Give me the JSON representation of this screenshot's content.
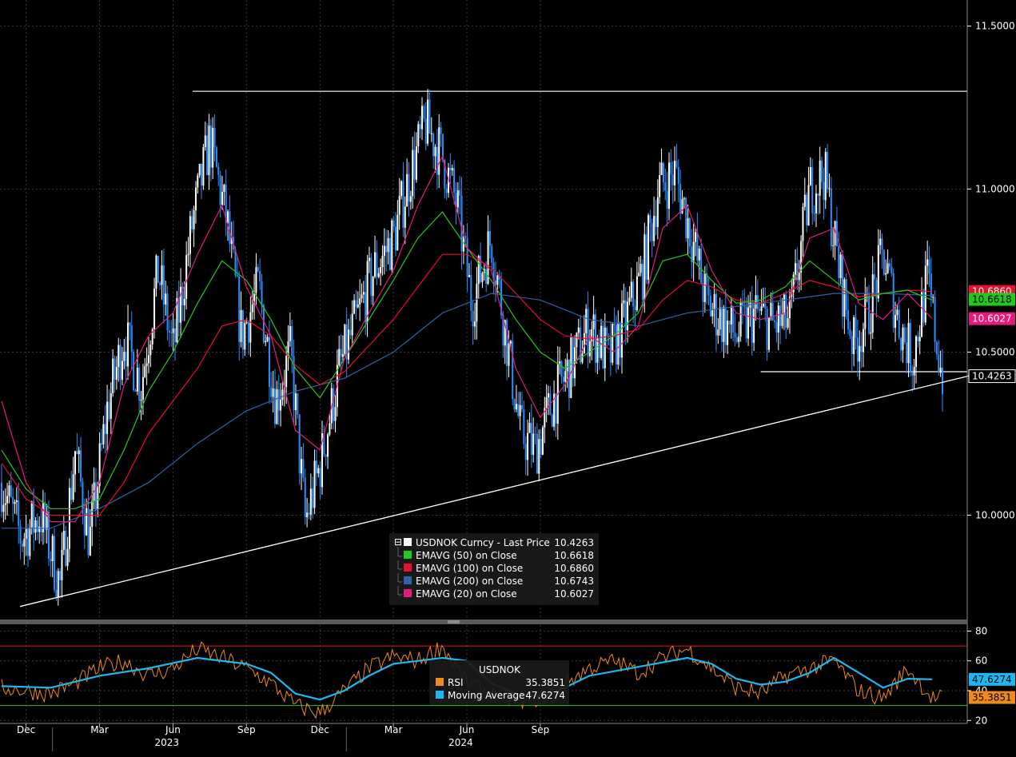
{
  "chart_data": {
    "type": "line",
    "price_panel": {
      "y_ticks": [
        "11.5000",
        "11.0000",
        "10.5000",
        "10.0000"
      ],
      "ylim": [
        9.68,
        11.58
      ],
      "grid": true,
      "legend_placement": "bottom-center",
      "colors": {
        "price": "#ffffff",
        "ema50": "#22c81e",
        "ema100": "#e8102a",
        "ema200": "#2f62a8",
        "ema20": "#e6197c",
        "trendline": "#ffffff",
        "candle_down": "#2b8fff"
      },
      "price_points": [
        {
          "x": 0.0,
          "y": 10.1
        },
        {
          "x": 0.8,
          "y": 9.93
        },
        {
          "x": 1.6,
          "y": 10.0
        },
        {
          "x": 2.4,
          "y": 9.78
        },
        {
          "x": 3.0,
          "y": 10.2
        },
        {
          "x": 3.6,
          "y": 9.92
        },
        {
          "x": 4.3,
          "y": 10.32
        },
        {
          "x": 5.0,
          "y": 10.55
        },
        {
          "x": 5.7,
          "y": 10.4
        },
        {
          "x": 6.4,
          "y": 10.75
        },
        {
          "x": 7.0,
          "y": 10.5
        },
        {
          "x": 7.8,
          "y": 10.9
        },
        {
          "x": 8.5,
          "y": 11.15
        },
        {
          "x": 9.2,
          "y": 10.9
        },
        {
          "x": 9.8,
          "y": 10.55
        },
        {
          "x": 10.5,
          "y": 10.7
        },
        {
          "x": 11.2,
          "y": 10.35
        },
        {
          "x": 11.8,
          "y": 10.5
        },
        {
          "x": 12.4,
          "y": 9.98
        },
        {
          "x": 13.0,
          "y": 10.15
        },
        {
          "x": 13.8,
          "y": 10.45
        },
        {
          "x": 14.5,
          "y": 10.6
        },
        {
          "x": 15.2,
          "y": 10.75
        },
        {
          "x": 16.0,
          "y": 10.85
        },
        {
          "x": 16.7,
          "y": 11.05
        },
        {
          "x": 17.3,
          "y": 11.2
        },
        {
          "x": 18.0,
          "y": 11.1
        },
        {
          "x": 18.6,
          "y": 10.95
        },
        {
          "x": 19.2,
          "y": 10.65
        },
        {
          "x": 20.0,
          "y": 10.85
        },
        {
          "x": 20.6,
          "y": 10.55
        },
        {
          "x": 21.2,
          "y": 10.25
        },
        {
          "x": 21.8,
          "y": 10.2
        },
        {
          "x": 22.5,
          "y": 10.35
        },
        {
          "x": 23.2,
          "y": 10.45
        },
        {
          "x": 24.0,
          "y": 10.58
        },
        {
          "x": 24.8,
          "y": 10.48
        },
        {
          "x": 25.5,
          "y": 10.6
        },
        {
          "x": 26.2,
          "y": 10.75
        },
        {
          "x": 26.8,
          "y": 11.0
        },
        {
          "x": 27.5,
          "y": 11.05
        },
        {
          "x": 28.2,
          "y": 10.85
        },
        {
          "x": 28.8,
          "y": 10.65
        },
        {
          "x": 29.4,
          "y": 10.6
        },
        {
          "x": 30.0,
          "y": 10.55
        },
        {
          "x": 30.8,
          "y": 10.62
        },
        {
          "x": 31.5,
          "y": 10.58
        },
        {
          "x": 32.2,
          "y": 10.6
        },
        {
          "x": 33.0,
          "y": 11.0
        },
        {
          "x": 33.6,
          "y": 11.05
        },
        {
          "x": 34.2,
          "y": 10.75
        },
        {
          "x": 34.8,
          "y": 10.52
        },
        {
          "x": 35.4,
          "y": 10.62
        },
        {
          "x": 36.0,
          "y": 10.8
        },
        {
          "x": 36.6,
          "y": 10.6
        },
        {
          "x": 37.2,
          "y": 10.48
        },
        {
          "x": 37.8,
          "y": 10.72
        },
        {
          "x": 38.4,
          "y": 10.43
        }
      ],
      "x_months_total": 39,
      "ema50_points": [
        [
          0,
          10.2
        ],
        [
          1,
          10.08
        ],
        [
          2,
          10.02
        ],
        [
          3,
          10.02
        ],
        [
          4,
          10.05
        ],
        [
          5,
          10.2
        ],
        [
          6,
          10.38
        ],
        [
          7,
          10.5
        ],
        [
          8,
          10.65
        ],
        [
          9,
          10.78
        ],
        [
          10,
          10.72
        ],
        [
          11,
          10.6
        ],
        [
          12,
          10.45
        ],
        [
          13,
          10.36
        ],
        [
          14,
          10.48
        ],
        [
          15,
          10.6
        ],
        [
          16,
          10.72
        ],
        [
          17,
          10.85
        ],
        [
          18,
          10.93
        ],
        [
          19,
          10.82
        ],
        [
          20,
          10.72
        ],
        [
          21,
          10.6
        ],
        [
          22,
          10.5
        ],
        [
          23,
          10.45
        ],
        [
          24,
          10.5
        ],
        [
          25,
          10.55
        ],
        [
          26,
          10.62
        ],
        [
          27,
          10.78
        ],
        [
          28,
          10.8
        ],
        [
          29,
          10.72
        ],
        [
          30,
          10.65
        ],
        [
          31,
          10.66
        ],
        [
          32,
          10.7
        ],
        [
          33,
          10.78
        ],
        [
          34,
          10.72
        ],
        [
          35,
          10.66
        ],
        [
          36,
          10.68
        ],
        [
          37,
          10.69
        ],
        [
          38,
          10.66
        ]
      ],
      "ema100_points": [
        [
          0,
          10.16
        ],
        [
          1,
          10.05
        ],
        [
          2,
          10.0
        ],
        [
          3,
          10.0
        ],
        [
          4,
          10.0
        ],
        [
          5,
          10.1
        ],
        [
          6,
          10.25
        ],
        [
          7,
          10.35
        ],
        [
          8,
          10.45
        ],
        [
          9,
          10.58
        ],
        [
          10,
          10.6
        ],
        [
          11,
          10.55
        ],
        [
          12,
          10.46
        ],
        [
          13,
          10.4
        ],
        [
          14,
          10.44
        ],
        [
          15,
          10.52
        ],
        [
          16,
          10.6
        ],
        [
          17,
          10.7
        ],
        [
          18,
          10.8
        ],
        [
          19,
          10.8
        ],
        [
          20,
          10.76
        ],
        [
          21,
          10.68
        ],
        [
          22,
          10.6
        ],
        [
          23,
          10.55
        ],
        [
          24,
          10.54
        ],
        [
          25,
          10.55
        ],
        [
          26,
          10.57
        ],
        [
          27,
          10.66
        ],
        [
          28,
          10.72
        ],
        [
          29,
          10.7
        ],
        [
          30,
          10.66
        ],
        [
          31,
          10.65
        ],
        [
          32,
          10.68
        ],
        [
          33,
          10.72
        ],
        [
          34,
          10.7
        ],
        [
          35,
          10.67
        ],
        [
          36,
          10.68
        ],
        [
          37,
          10.69
        ],
        [
          38,
          10.686
        ]
      ],
      "ema200_points": [
        [
          0,
          9.96
        ],
        [
          2,
          9.96
        ],
        [
          4,
          10.02
        ],
        [
          6,
          10.1
        ],
        [
          8,
          10.22
        ],
        [
          10,
          10.32
        ],
        [
          12,
          10.38
        ],
        [
          14,
          10.42
        ],
        [
          16,
          10.5
        ],
        [
          18,
          10.62
        ],
        [
          20,
          10.68
        ],
        [
          22,
          10.66
        ],
        [
          24,
          10.6
        ],
        [
          26,
          10.58
        ],
        [
          28,
          10.62
        ],
        [
          30,
          10.64
        ],
        [
          32,
          10.66
        ],
        [
          34,
          10.68
        ],
        [
          36,
          10.68
        ],
        [
          38,
          10.674
        ]
      ],
      "ema20_points": [
        [
          0,
          10.35
        ],
        [
          1,
          10.1
        ],
        [
          2,
          9.98
        ],
        [
          3,
          9.98
        ],
        [
          4,
          10.1
        ],
        [
          5,
          10.4
        ],
        [
          6,
          10.55
        ],
        [
          7,
          10.62
        ],
        [
          8,
          10.8
        ],
        [
          9,
          10.95
        ],
        [
          10,
          10.7
        ],
        [
          11,
          10.55
        ],
        [
          12,
          10.26
        ],
        [
          13,
          10.2
        ],
        [
          14,
          10.48
        ],
        [
          15,
          10.62
        ],
        [
          16,
          10.75
        ],
        [
          17,
          10.95
        ],
        [
          18,
          11.1
        ],
        [
          19,
          10.82
        ],
        [
          20,
          10.75
        ],
        [
          21,
          10.45
        ],
        [
          22,
          10.3
        ],
        [
          23,
          10.4
        ],
        [
          24,
          10.55
        ],
        [
          25,
          10.5
        ],
        [
          26,
          10.58
        ],
        [
          27,
          10.88
        ],
        [
          28,
          10.95
        ],
        [
          29,
          10.75
        ],
        [
          30,
          10.62
        ],
        [
          31,
          10.6
        ],
        [
          32,
          10.62
        ],
        [
          33,
          10.85
        ],
        [
          34,
          10.88
        ],
        [
          35,
          10.65
        ],
        [
          36,
          10.6
        ],
        [
          37,
          10.68
        ],
        [
          38,
          10.603
        ]
      ],
      "trendline": {
        "from": {
          "x": 0.75,
          "y": 9.72
        },
        "to": {
          "x": 39.0,
          "y": 10.43
        }
      },
      "rect_top": {
        "y": 11.3,
        "x_from": 7.8
      },
      "support_line": {
        "y": 10.44,
        "x_from": 31.0
      }
    },
    "value_tags": [
      {
        "label": "10.6860",
        "bg": "#e8102a",
        "fg": "#ffffff",
        "y": 10.686
      },
      {
        "label": "10.6618",
        "bg": "#22c81e",
        "fg": "#000000",
        "y": 10.6618
      },
      {
        "label": "10.6027",
        "bg": "#e6197c",
        "fg": "#ffffff",
        "y": 10.6027
      },
      {
        "label": "10.4263",
        "bg": "#000000",
        "fg": "#ffffff",
        "y": 10.4263
      }
    ],
    "legend": {
      "title_row": {
        "name": "USDNOK Curncy - Last Price",
        "value": "10.4263",
        "swatch": "#ffffff"
      },
      "rows": [
        {
          "name": "EMAVG (50)  on Close",
          "value": "10.6618",
          "swatch": "#22c81e"
        },
        {
          "name": "EMAVG (100)  on Close",
          "value": "10.6860",
          "swatch": "#e8102a"
        },
        {
          "name": "EMAVG (200)  on Close",
          "value": "10.6743",
          "swatch": "#2f62a8"
        },
        {
          "name": "EMAVG (20)  on Close",
          "value": "10.6027",
          "swatch": "#e6197c"
        }
      ]
    },
    "rsi_panel": {
      "y_ticks": [
        "80",
        "60",
        "40",
        "20"
      ],
      "ylim": [
        18,
        84
      ],
      "upper_line": 70,
      "lower_line": 30,
      "colors": {
        "rsi": "#f08a1a",
        "ma": "#1eb6f0",
        "upper": "#e8102a",
        "lower": "#22c81e"
      },
      "rsi_points": [
        [
          0,
          42
        ],
        [
          1,
          40
        ],
        [
          2,
          38
        ],
        [
          3,
          45
        ],
        [
          4,
          55
        ],
        [
          5,
          60
        ],
        [
          6,
          50
        ],
        [
          7,
          55
        ],
        [
          8,
          68
        ],
        [
          9,
          62
        ],
        [
          10,
          55
        ],
        [
          11,
          45
        ],
        [
          12,
          30
        ],
        [
          13,
          25
        ],
        [
          14,
          40
        ],
        [
          15,
          55
        ],
        [
          16,
          63
        ],
        [
          17,
          60
        ],
        [
          18,
          70
        ],
        [
          19,
          45
        ],
        [
          20,
          38
        ],
        [
          21,
          33
        ],
        [
          22,
          35
        ],
        [
          23,
          45
        ],
        [
          24,
          55
        ],
        [
          25,
          60
        ],
        [
          26,
          52
        ],
        [
          27,
          62
        ],
        [
          28,
          68
        ],
        [
          29,
          55
        ],
        [
          30,
          42
        ],
        [
          31,
          38
        ],
        [
          32,
          50
        ],
        [
          33,
          55
        ],
        [
          34,
          60
        ],
        [
          35,
          40
        ],
        [
          36,
          35
        ],
        [
          37,
          55
        ],
        [
          38,
          35
        ]
      ],
      "ma_points": [
        [
          0,
          43
        ],
        [
          2,
          42
        ],
        [
          4,
          50
        ],
        [
          6,
          55
        ],
        [
          8,
          62
        ],
        [
          10,
          58
        ],
        [
          11,
          52
        ],
        [
          12,
          38
        ],
        [
          13,
          34
        ],
        [
          14,
          40
        ],
        [
          15,
          50
        ],
        [
          16,
          58
        ],
        [
          18,
          62
        ],
        [
          19,
          60
        ],
        [
          20,
          45
        ],
        [
          21,
          38
        ],
        [
          22,
          36
        ],
        [
          23,
          42
        ],
        [
          24,
          50
        ],
        [
          26,
          56
        ],
        [
          28,
          62
        ],
        [
          29,
          58
        ],
        [
          30,
          48
        ],
        [
          31,
          44
        ],
        [
          32,
          46
        ],
        [
          33,
          52
        ],
        [
          34,
          62
        ],
        [
          35,
          52
        ],
        [
          36,
          42
        ],
        [
          37,
          48
        ],
        [
          38,
          47.6
        ]
      ],
      "legend": {
        "title": "USDNOK",
        "rows": [
          {
            "name": "RSI",
            "value": "35.3851",
            "swatch": "#f08a1a"
          },
          {
            "name": "Moving Average",
            "value": "47.6274",
            "swatch": "#1eb6f0"
          }
        ]
      },
      "value_tags": [
        {
          "label": "47.6274",
          "bg": "#1eb6f0",
          "fg": "#000000",
          "y": 47.6
        },
        {
          "label": "35.3851",
          "bg": "#f08a1a",
          "fg": "#000000",
          "y": 35.4
        }
      ]
    },
    "x_axis": {
      "month_labels": [
        {
          "label": "Dec",
          "m": 1
        },
        {
          "label": "Mar",
          "m": 4
        },
        {
          "label": "Jun",
          "m": 7
        },
        {
          "label": "Sep",
          "m": 10
        },
        {
          "label": "Dec",
          "m": 13
        },
        {
          "label": "Mar",
          "m": 16
        },
        {
          "label": "Jun",
          "m": 19
        },
        {
          "label": "Sep",
          "m": 22
        }
      ],
      "year_labels": [
        {
          "label": "2023",
          "m": 6.75
        },
        {
          "label": "2024",
          "m": 18.75
        }
      ]
    }
  }
}
